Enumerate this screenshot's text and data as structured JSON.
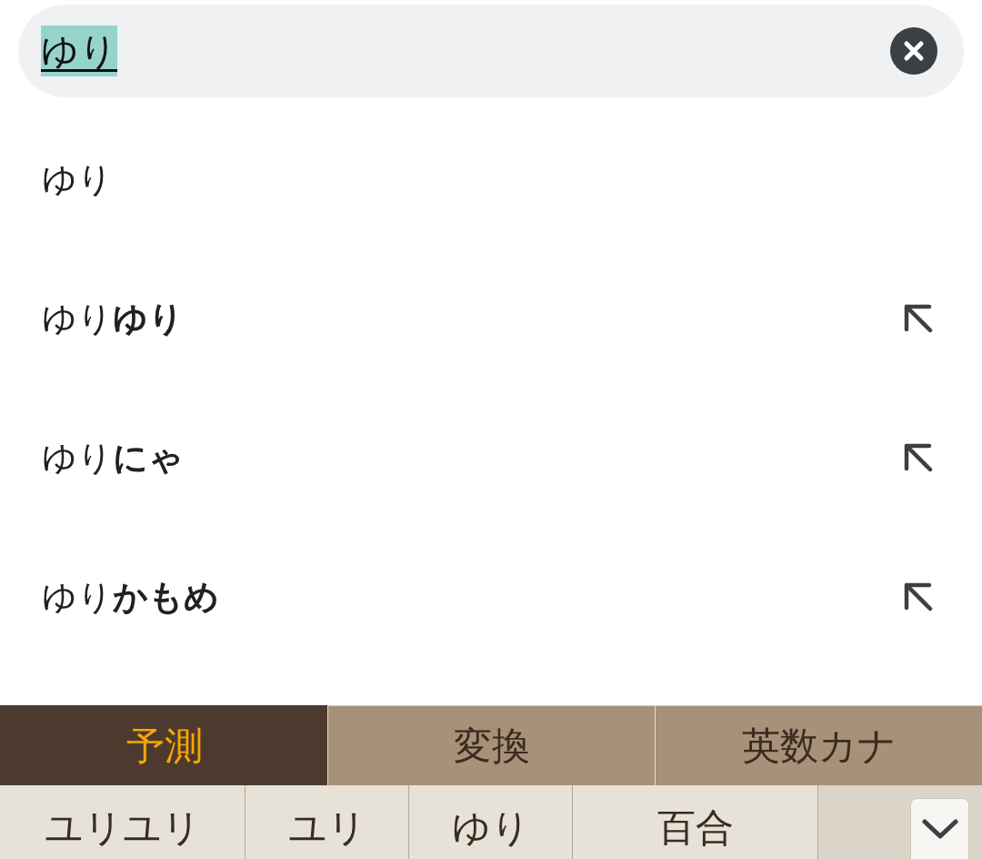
{
  "search": {
    "value": "ゆり",
    "composing": true
  },
  "suggestions": [
    {
      "text": "ゆり",
      "kind": "query"
    },
    {
      "text": "ゆり**ゆり**",
      "kind": "completion"
    },
    {
      "text": "ゆり**にゃ**",
      "kind": "completion"
    },
    {
      "text": "ゆり**かもめ**",
      "kind": "completion"
    }
  ],
  "keyboard": {
    "tabs": [
      {
        "label": "予測",
        "selected": true
      },
      {
        "label": "変換",
        "selected": false
      },
      {
        "label": "英数カナ",
        "selected": false
      }
    ],
    "candidates": [
      "ユリユリ",
      "ユリ",
      "ゆり",
      "百合"
    ]
  }
}
